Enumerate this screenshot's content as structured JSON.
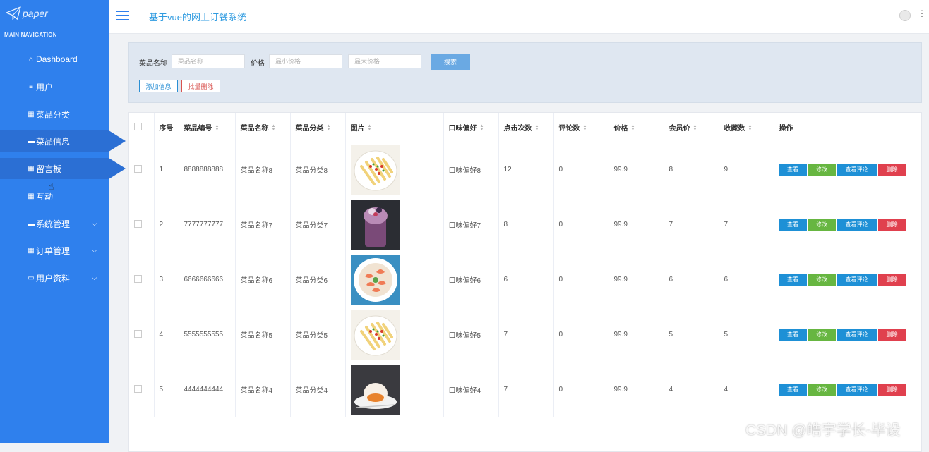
{
  "brand": {
    "name": "paper"
  },
  "sidebar": {
    "heading": "MAIN NAVIGATION",
    "items": [
      {
        "icon": "home-icon",
        "glyph": "⌂",
        "label": "Dashboard"
      },
      {
        "icon": "list-icon",
        "glyph": "≡",
        "label": "用户"
      },
      {
        "icon": "grid-icon",
        "glyph": "▦",
        "label": "菜品分类"
      },
      {
        "icon": "card-icon",
        "glyph": "▬",
        "label": "菜品信息"
      },
      {
        "icon": "grid-icon",
        "glyph": "▦",
        "label": "留言板"
      },
      {
        "icon": "grid-icon",
        "glyph": "▦",
        "label": "互动"
      },
      {
        "icon": "chat-icon",
        "glyph": "▬",
        "label": "系统管理"
      },
      {
        "icon": "grid-icon",
        "glyph": "▦",
        "label": "订单管理"
      },
      {
        "icon": "profile-icon",
        "glyph": "▭",
        "label": "用户资料"
      }
    ]
  },
  "header": {
    "title": "基于vue的网上订餐系统"
  },
  "search": {
    "name_label": "菜品名称",
    "name_placeholder": "菜品名称",
    "price_label": "价格",
    "min_placeholder": "最小价格",
    "max_placeholder": "最大价格",
    "search_button": "搜索",
    "add_button": "添加信息",
    "bulk_delete_button": "批量删除"
  },
  "table": {
    "headers": {
      "index": "序号",
      "code": "菜品编号",
      "name": "菜品名称",
      "category": "菜品分类",
      "image": "图片",
      "taste": "口味偏好",
      "clicks": "点击次数",
      "comments": "评论数",
      "price": "价格",
      "member_price": "会员价",
      "favorites": "收藏数",
      "actions": "操作"
    },
    "actions": {
      "view": "查看",
      "edit": "修改",
      "view_comments": "查看评论",
      "delete": "删除"
    },
    "rows": [
      {
        "index": "1",
        "code": "8888888888",
        "name": "菜品名称8",
        "category": "菜品分类8",
        "image": "fries-dish",
        "taste": "口味偏好8",
        "clicks": "12",
        "comments": "0",
        "price": "99.9",
        "member_price": "8",
        "favorites": "9"
      },
      {
        "index": "2",
        "code": "7777777777",
        "name": "菜品名称7",
        "category": "菜品分类7",
        "image": "berry-smoothie",
        "taste": "口味偏好7",
        "clicks": "8",
        "comments": "0",
        "price": "99.9",
        "member_price": "7",
        "favorites": "7"
      },
      {
        "index": "3",
        "code": "6666666666",
        "name": "菜品名称6",
        "category": "菜品分类6",
        "image": "shrimp-plate",
        "taste": "口味偏好6",
        "clicks": "6",
        "comments": "0",
        "price": "99.9",
        "member_price": "6",
        "favorites": "6"
      },
      {
        "index": "4",
        "code": "5555555555",
        "name": "菜品名称5",
        "category": "菜品分类5",
        "image": "fries-dish",
        "taste": "口味偏好5",
        "clicks": "7",
        "comments": "0",
        "price": "99.9",
        "member_price": "5",
        "favorites": "5"
      },
      {
        "index": "5",
        "code": "4444444444",
        "name": "菜品名称4",
        "category": "菜品分类4",
        "image": "dessert-cake",
        "taste": "口味偏好4",
        "clicks": "7",
        "comments": "0",
        "price": "99.9",
        "member_price": "4",
        "favorites": "4"
      }
    ]
  },
  "watermark": "CSDN @皓宇学长-毕设",
  "colors": {
    "sidebar": "#2f80ed",
    "active": "#2b6fd4",
    "title": "#2f9be0",
    "view": "#1e90d6",
    "edit": "#67b641",
    "delete": "#e0404e"
  }
}
